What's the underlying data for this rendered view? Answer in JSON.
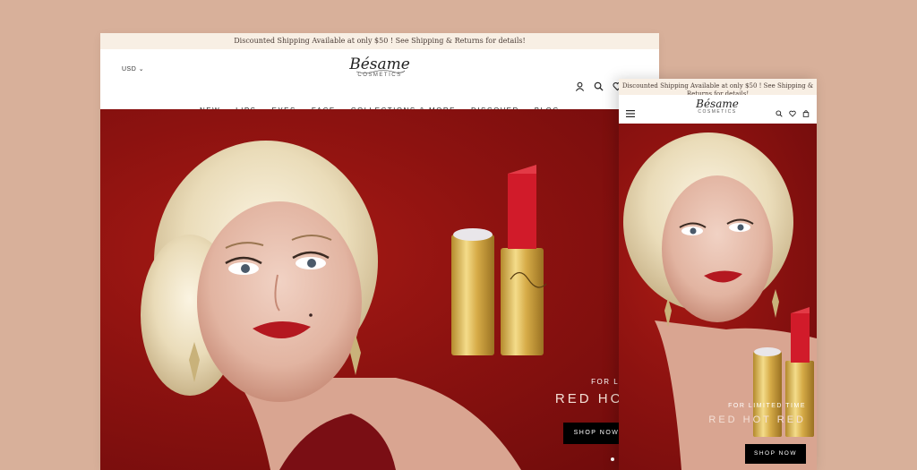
{
  "promo": {
    "text": "Discounted Shipping Available at only $50 ! See Shipping & Returns for details!",
    "text_mobile": "Discounted Shipping Available at only $50 ! See Shipping & Returns for details!"
  },
  "header": {
    "currency": "USD",
    "brand": "Bésame",
    "brand_sub": "COSMETICS",
    "icons": [
      "account-icon",
      "search-icon",
      "wishlist-heart-icon",
      "cart-bag-icon"
    ]
  },
  "nav": {
    "items": [
      "NEW",
      "LIPS",
      "EYES",
      "FACE",
      "COLLECTIONS & MORE",
      "DISCOVER",
      "BLOG"
    ]
  },
  "hero": {
    "kicker": "FOR LIMITED TIME",
    "headline": "RED HOT RED",
    "cta": "SHOP NOW",
    "slides": 2,
    "active_slide": 1
  },
  "colors": {
    "background": "#d8b09a",
    "promo_bar": "#f8efe4",
    "hero_red": "#8c1210",
    "cta": "#000000"
  }
}
